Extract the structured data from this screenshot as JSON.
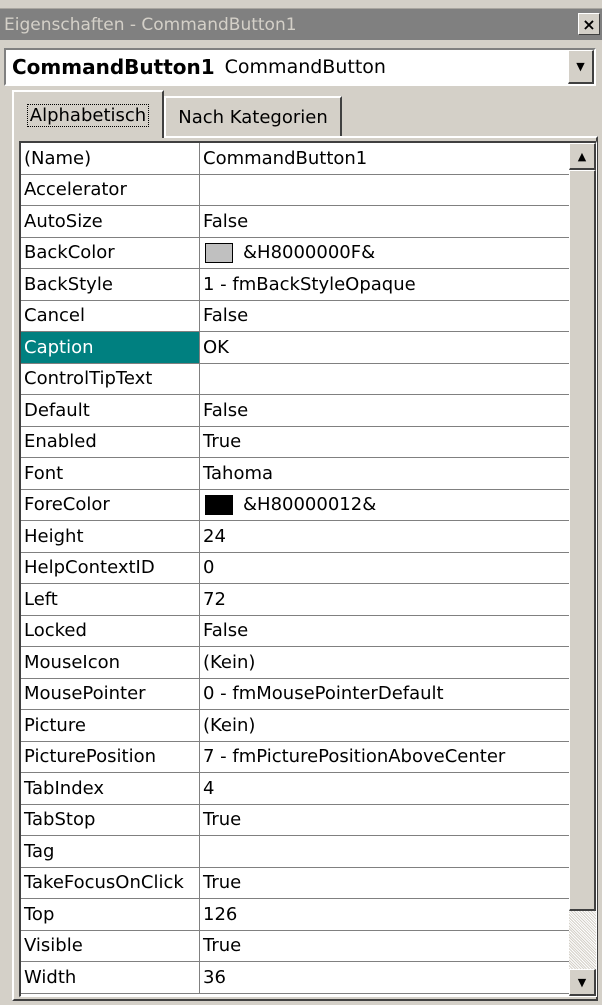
{
  "window": {
    "title": "Eigenschaften - CommandButton1",
    "close_symbol": "×"
  },
  "object_selector": {
    "name": "CommandButton1",
    "type": "CommandButton",
    "arrow": "▼"
  },
  "tabs": [
    {
      "label": "Alphabetisch",
      "active": true
    },
    {
      "label": "Nach Kategorien",
      "active": false
    }
  ],
  "scrollbar": {
    "up_arrow": "▲",
    "down_arrow": "▼"
  },
  "properties": [
    {
      "name": "(Name)",
      "value": "CommandButton1"
    },
    {
      "name": "Accelerator",
      "value": ""
    },
    {
      "name": "AutoSize",
      "value": "False"
    },
    {
      "name": "BackColor",
      "value": "&H8000000F&",
      "swatch": "#c0c0c0"
    },
    {
      "name": "BackStyle",
      "value": "1 - fmBackStyleOpaque"
    },
    {
      "name": "Cancel",
      "value": "False"
    },
    {
      "name": "Caption",
      "value": "OK",
      "selected": true
    },
    {
      "name": "ControlTipText",
      "value": ""
    },
    {
      "name": "Default",
      "value": "False"
    },
    {
      "name": "Enabled",
      "value": "True"
    },
    {
      "name": "Font",
      "value": "Tahoma"
    },
    {
      "name": "ForeColor",
      "value": "&H80000012&",
      "swatch": "#000000"
    },
    {
      "name": "Height",
      "value": "24"
    },
    {
      "name": "HelpContextID",
      "value": "0"
    },
    {
      "name": "Left",
      "value": "72"
    },
    {
      "name": "Locked",
      "value": "False"
    },
    {
      "name": "MouseIcon",
      "value": "(Kein)"
    },
    {
      "name": "MousePointer",
      "value": "0 - fmMousePointerDefault"
    },
    {
      "name": "Picture",
      "value": "(Kein)"
    },
    {
      "name": "PicturePosition",
      "value": "7 - fmPicturePositionAboveCenter"
    },
    {
      "name": "TabIndex",
      "value": "4"
    },
    {
      "name": "TabStop",
      "value": "True"
    },
    {
      "name": "Tag",
      "value": ""
    },
    {
      "name": "TakeFocusOnClick",
      "value": "True"
    },
    {
      "name": "Top",
      "value": "126"
    },
    {
      "name": "Visible",
      "value": "True"
    },
    {
      "name": "Width",
      "value": "36"
    }
  ],
  "colors": {
    "title_inactive": "#808080",
    "selection": "#008080",
    "face": "#d4d0c8"
  }
}
